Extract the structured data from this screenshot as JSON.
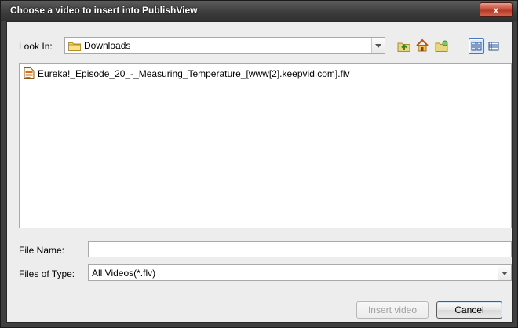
{
  "window": {
    "title": "Choose a video to insert into PublishView",
    "close_glyph": "x"
  },
  "look_in": {
    "label": "Look In:",
    "value": "Downloads",
    "icon": "folder-icon"
  },
  "toolbar": {
    "icons": [
      "up-one-level-icon",
      "home-icon",
      "new-folder-icon",
      "list-view-icon",
      "details-view-icon"
    ],
    "active_view": "list-view"
  },
  "files": [
    {
      "name": "Eureka!_Episode_20_-_Measuring_Temperature_[www[2].keepvid.com].flv",
      "icon": "video-file-icon"
    }
  ],
  "file_name": {
    "label": "File Name:",
    "value": ""
  },
  "files_of_type": {
    "label": "Files of Type:",
    "value": "All Videos(*.flv)"
  },
  "buttons": {
    "insert_label": "Insert video",
    "cancel_label": "Cancel"
  },
  "colors": {
    "title_bar": "#3d3d3d",
    "close_button": "#c84a36",
    "dialog_bg": "#ededed"
  }
}
